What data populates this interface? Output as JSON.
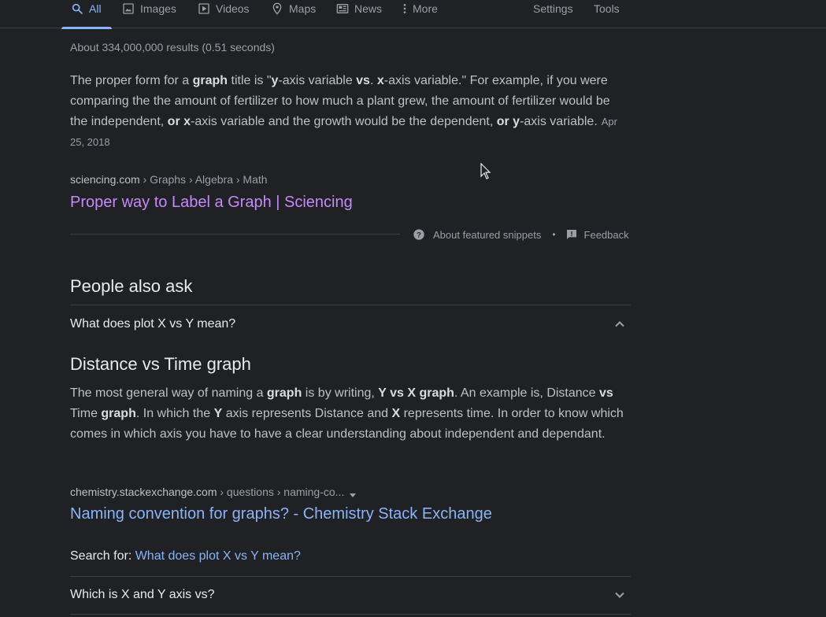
{
  "tabs": [
    {
      "label": "All",
      "icon": "search-icon",
      "active": true
    },
    {
      "label": "Images",
      "icon": "image-icon"
    },
    {
      "label": "Videos",
      "icon": "play-icon"
    },
    {
      "label": "Maps",
      "icon": "map-pin-icon"
    },
    {
      "label": "News",
      "icon": "newspaper-icon"
    },
    {
      "label": "More",
      "icon": "more-vert-icon"
    }
  ],
  "tools": {
    "settings": "Settings",
    "tools": "Tools"
  },
  "result_stats": "About 334,000,000 results (0.51 seconds)",
  "featured_snippet": {
    "text_parts": {
      "p1": "The proper form for a ",
      "b1": "graph",
      "p2": " title is \"",
      "b2": "y",
      "p3": "-axis variable ",
      "b3": "vs",
      "p4": ". ",
      "b4": "x",
      "p5": "-axis variable.\" For example, if you were comparing the the amount of fertilizer to how much a plant grew, the amount of fertilizer would be the independent, ",
      "b5": "or x",
      "p6": "-axis variable and the growth would be the dependent, ",
      "b6": "or y",
      "p7": "-axis variable."
    },
    "date": "Apr 25, 2018",
    "cite_domain": "sciencing.com",
    "cite_path": " › Graphs › Algebra › Math",
    "title": "Proper way to Label a Graph | Sciencing",
    "about_label": "About featured snippets",
    "separator": "•",
    "feedback_label": "Feedback"
  },
  "people_also_ask": {
    "heading": "People also ask",
    "questions": [
      {
        "text": "What does plot X vs Y mean?",
        "expanded": true
      },
      {
        "text": "Which is X and Y axis vs?",
        "expanded": false
      }
    ],
    "answer": {
      "title": "Distance vs Time graph",
      "parts": {
        "p1": "The most general way of naming a ",
        "b1": "graph",
        "p2": " is by writing, ",
        "b2": "Y vs X graph",
        "p3": ". An example is, Distance ",
        "b3": "vs",
        "p4": " Time ",
        "b4": "graph",
        "p5": ". In which the ",
        "b5": "Y",
        "p6": " axis represents Distance and ",
        "b6": "X",
        "p7": " represents time. In order to know which comes in which axis you have to have a clear understanding about independent and dependant."
      },
      "cite_domain": "chemistry.stackexchange.com",
      "cite_path": " › questions › naming-co...",
      "title_link": "Naming convention for graphs? - Chemistry Stack Exchange",
      "search_for_label": "Search for: ",
      "search_for_query": "What does plot X vs Y mean?"
    }
  },
  "colors": {
    "background": "#202124",
    "link": "#8ab4f8",
    "visited_link": "#c58af9",
    "text": "#bdc1c6"
  }
}
